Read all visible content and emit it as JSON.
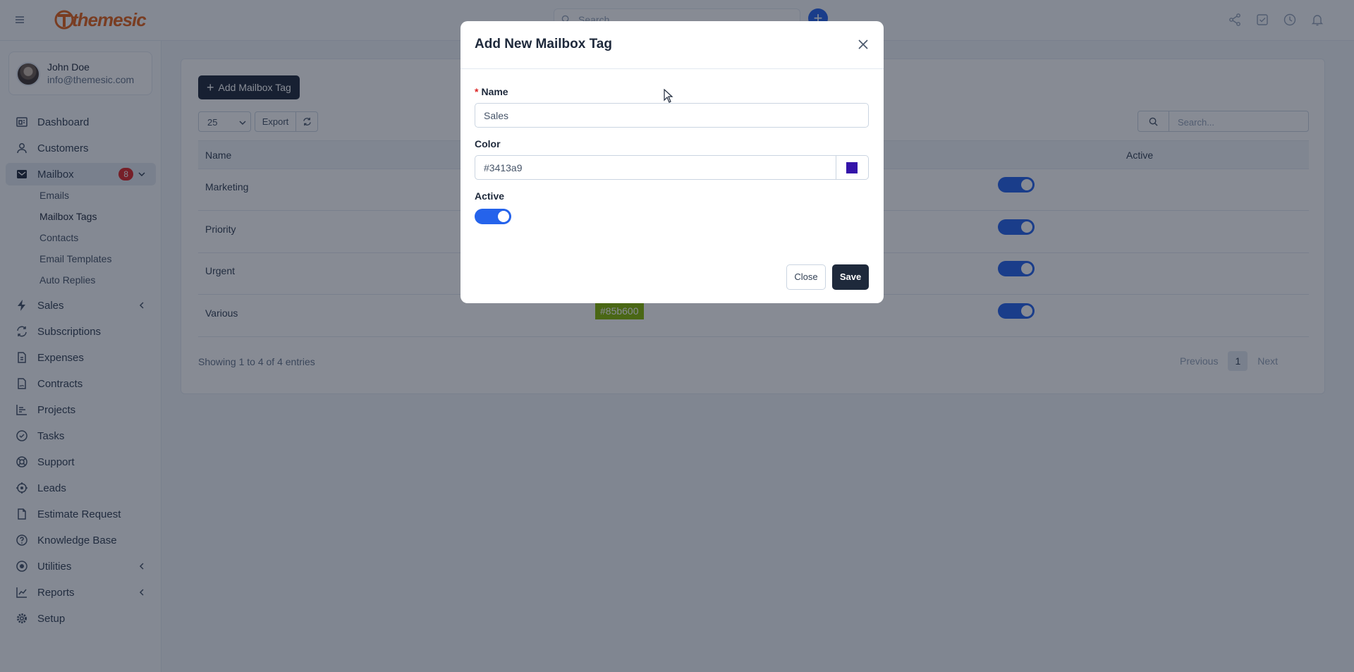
{
  "header": {
    "logo_text": "themesic",
    "search_placeholder": "Search...",
    "add_button": "+",
    "icons": [
      "share-icon",
      "check-square-icon",
      "clock-icon",
      "bell-icon"
    ]
  },
  "user": {
    "name": "John Doe",
    "email": "info@themesic.com"
  },
  "sidebar": {
    "items": [
      {
        "label": "Dashboard",
        "icon": "dashboard-icon"
      },
      {
        "label": "Customers",
        "icon": "user-icon"
      },
      {
        "label": "Mailbox",
        "icon": "mail-icon",
        "badge": "8"
      },
      {
        "label": "Sales",
        "icon": "bolt-icon"
      },
      {
        "label": "Subscriptions",
        "icon": "refresh-icon"
      },
      {
        "label": "Expenses",
        "icon": "file-icon"
      },
      {
        "label": "Contracts",
        "icon": "contract-icon"
      },
      {
        "label": "Projects",
        "icon": "chart-icon"
      },
      {
        "label": "Tasks",
        "icon": "check-circle-icon"
      },
      {
        "label": "Support",
        "icon": "lifebuoy-icon"
      },
      {
        "label": "Leads",
        "icon": "target-icon"
      },
      {
        "label": "Estimate Request",
        "icon": "document-icon"
      },
      {
        "label": "Knowledge Base",
        "icon": "question-icon"
      },
      {
        "label": "Utilities",
        "icon": "circle-dot-icon"
      },
      {
        "label": "Reports",
        "icon": "trend-icon"
      },
      {
        "label": "Setup",
        "icon": "gear-icon"
      }
    ],
    "mailbox_sub": [
      "Emails",
      "Mailbox Tags",
      "Contacts",
      "Email Templates",
      "Auto Replies"
    ]
  },
  "main": {
    "add_button": "Add Mailbox Tag",
    "page_length": "25",
    "export_label": "Export",
    "search_placeholder": "Search...",
    "columns": [
      "Name",
      "Active"
    ],
    "rows": [
      {
        "name": "Marketing",
        "active": true
      },
      {
        "name": "Priority",
        "active": true
      },
      {
        "name": "Urgent",
        "active": true
      },
      {
        "name": "Various",
        "color": "#85b600",
        "active": true
      }
    ],
    "showing": "Showing 1 to 4 of 4 entries",
    "pagination": {
      "previous": "Previous",
      "current": "1",
      "next": "Next"
    }
  },
  "modal": {
    "title": "Add New Mailbox Tag",
    "name_label": "Name",
    "name_value": "Sales",
    "color_label": "Color",
    "color_value": "#3413a9",
    "active_label": "Active",
    "active": true,
    "close_label": "Close",
    "save_label": "Save"
  },
  "colors": {
    "accent": "#2563eb",
    "dark_button": "#1e293b",
    "badge": "#dc2626",
    "logo": "#e2621b"
  }
}
